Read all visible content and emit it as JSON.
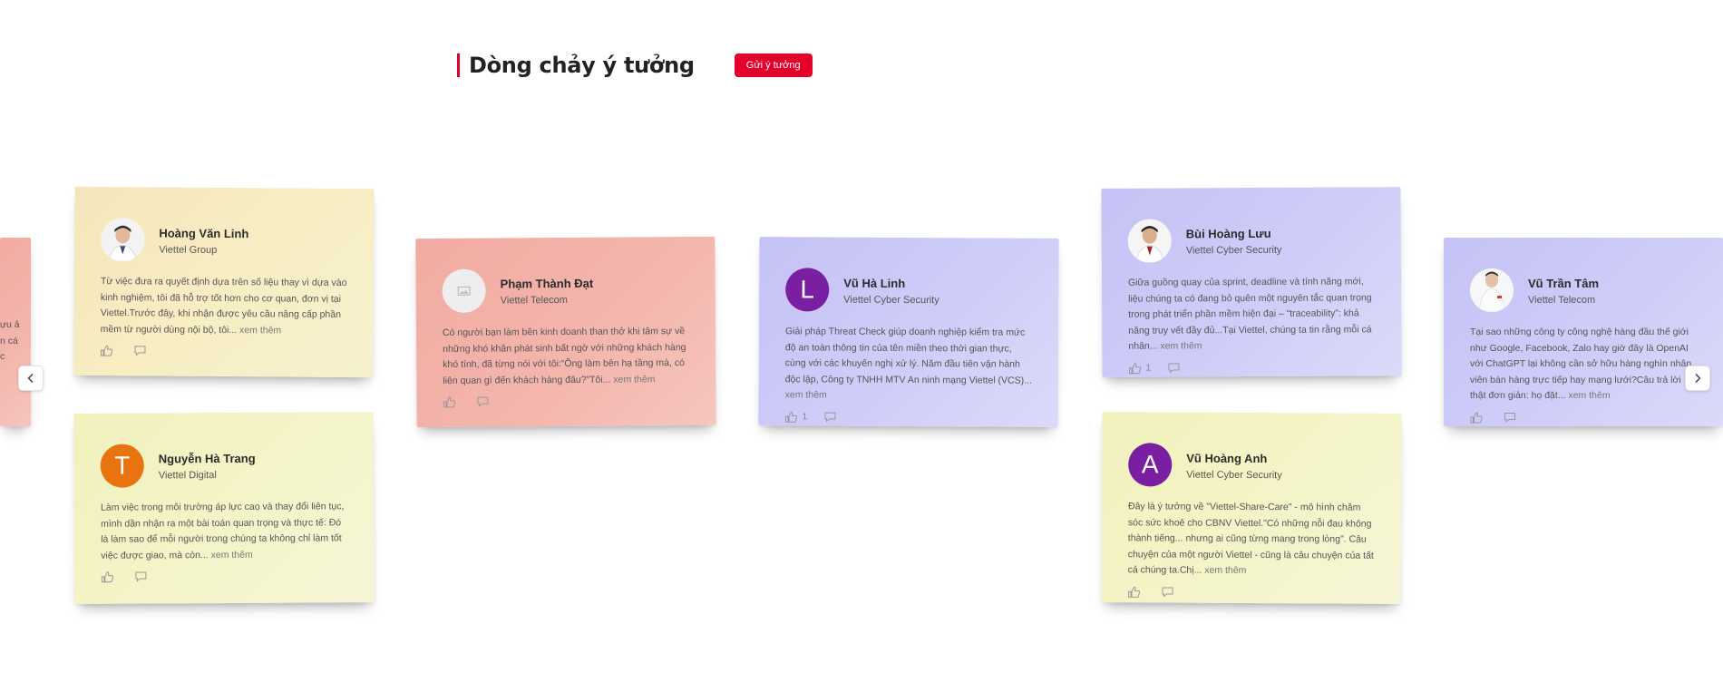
{
  "header": {
    "title": "Dòng chảy ý tưởng",
    "submit_label": "Gửi ý tưởng"
  },
  "colors": {
    "accent": "#e4002b",
    "note_yellow": "#f6e5bb",
    "note_lime": "#f2f2c2",
    "note_pink": "#f2aba2",
    "note_violet": "#c9c6f7"
  },
  "more_label": "xem thêm",
  "notes": [
    {
      "name": "Hoàng Văn Linh",
      "company": "Viettel Group",
      "avatar": "photo",
      "content": "Từ việc đưa ra quyết định dựa trên số liệu thay vì dựa vào kinh nghiệm, tôi đã hỗ trợ tốt hơn cho cơ quan, đơn vị tại Viettel.Trước đây, khi nhận được yêu cầu nâng cấp phần mềm từ người dùng nội bộ, tôi...",
      "likes": "",
      "comments": ""
    },
    {
      "name": "Nguyễn Hà Trang",
      "company": "Viettel Digital",
      "avatar": "T",
      "content": " Làm việc trong môi trường áp lực cao và thay đổi liên tục, mình dần nhận ra một bài toán quan trọng và thực tế: Đó là làm sao để mỗi người trong chúng ta không chỉ làm tốt việc được giao, mà còn...",
      "likes": "",
      "comments": ""
    },
    {
      "name": "Phạm Thành Đạt",
      "company": "Viettel Telecom",
      "avatar": "placeholder",
      "content": " Có người bạn làm bên kinh doanh than thở khi tâm sự về những khó khăn phát sinh bất ngờ với những khách hàng khó tính, đã từng nói với tôi:“Ông làm bên hạ tầng mà, có liên quan gì đến khách hàng đâu?”Tôi...",
      "likes": "",
      "comments": ""
    },
    {
      "name": "Vũ Hà Linh",
      "company": "Viettel Cyber Security",
      "avatar": "L",
      "content": "Giải pháp Threat Check giúp doanh nghiệp kiểm tra mức độ an toàn thông tin của tên miền theo thời gian thực, cùng với các khuyến nghị xử lý. Năm đầu tiên vận hành độc lập, Công ty TNHH MTV An ninh mạng Viettel (VCS)...",
      "likes": "1",
      "comments": ""
    },
    {
      "name": "Bùi Hoàng Lưu",
      "company": "Viettel Cyber Security",
      "avatar": "photo",
      "content": "Giữa guồng quay của sprint, deadline và tính năng mới, liệu chúng ta có đang bỏ quên một nguyên tắc quan trọng trong phát triển phần mềm hiện đại – “traceability”: khả năng truy vết đầy đủ...Tại Viettel, chúng ta tin rằng mỗi cá nhân...",
      "likes": "1",
      "comments": ""
    },
    {
      "name": "Vũ Hoàng Anh",
      "company": "Viettel Cyber Security",
      "avatar": "A",
      "content": "Đây là ý tưởng về \"Viettel-Share-Care\" - mô hình chăm sóc sức khoẻ cho CBNV Viettel.\"Có những nỗi đau không thành tiếng... nhưng ai cũng từng mang trong lòng\". Câu chuyện của một người Viettel - cũng là câu chuyện của tất cả chúng ta.Chị...",
      "likes": "",
      "comments": ""
    },
    {
      "name": "Vũ Trần Tâm",
      "company": "Viettel Telecom",
      "avatar": "photo",
      "content": "Tại sao những công ty công nghệ hàng đầu thế giới như Google, Facebook, Zalo hay giờ đây là OpenAI với ChatGPT lại không cần sở hữu hàng nghìn nhân viên bán hàng trực tiếp hay mạng lưới?Câu trả lời thật đơn giản: họ đặt...",
      "likes": "",
      "comments": ""
    },
    {
      "name": "",
      "company": "",
      "avatar": "",
      "content": "ựu ản các",
      "likes": "",
      "comments": ""
    }
  ],
  "nav": {
    "prev_icon": "chevron-left-icon",
    "next_icon": "chevron-right-icon"
  }
}
